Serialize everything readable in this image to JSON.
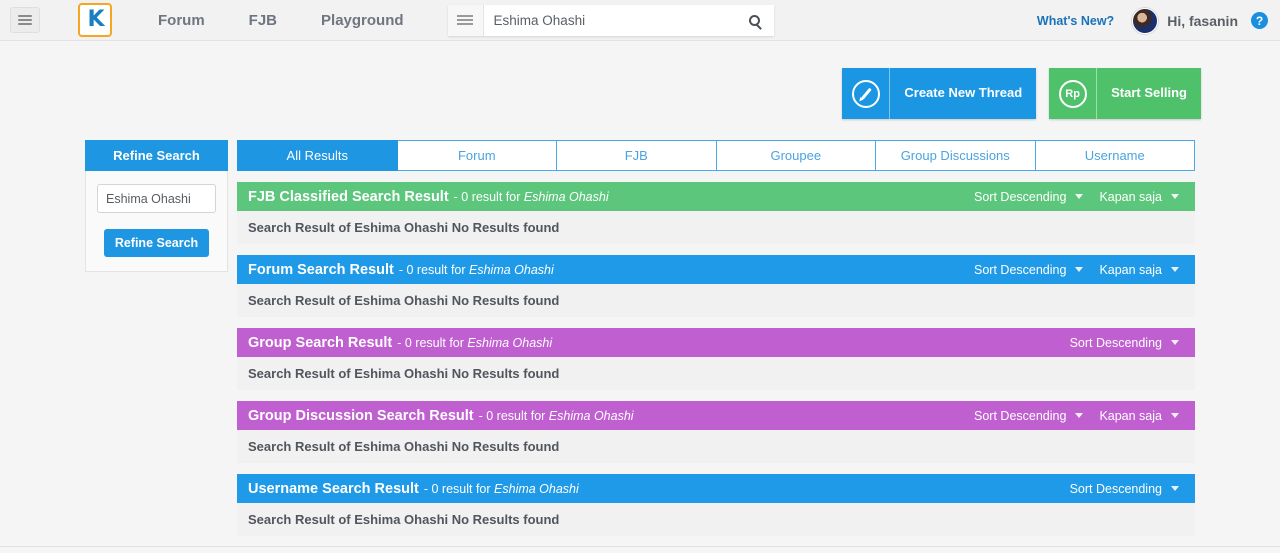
{
  "topnav": {
    "menu_icon": "hamburger-icon",
    "logo_text": "K",
    "links": [
      {
        "label": "Forum"
      },
      {
        "label": "FJB"
      },
      {
        "label": "Playground"
      }
    ],
    "search": {
      "category_icon": "hamburger-icon",
      "value": "Eshima Ohashi",
      "placeholder": "Search...",
      "submit_icon": "search-icon"
    },
    "whats_new": "What's New?",
    "avatar_name": "avatar",
    "greeting": "Hi, fasanin",
    "help_label": "?"
  },
  "actions": {
    "create_thread": {
      "label": "Create New Thread",
      "icon": "pencil-circle-icon"
    },
    "start_selling": {
      "label": "Start Selling",
      "icon": "rupiah-circle-icon",
      "icon_text": "Rp"
    }
  },
  "sidebar": {
    "title": "Refine Search",
    "input_value": "Eshima Ohashi",
    "input_placeholder": "Search...",
    "button_label": "Refine Search"
  },
  "tabs": [
    {
      "label": "All Results",
      "active": true
    },
    {
      "label": "Forum",
      "active": false
    },
    {
      "label": "FJB",
      "active": false
    },
    {
      "label": "Groupee",
      "active": false
    },
    {
      "label": "Group Discussions",
      "active": false
    },
    {
      "label": "Username",
      "active": false
    }
  ],
  "results": [
    {
      "title": "FJB Classified Search Result",
      "meta_prefix": "- 0 result for",
      "query": "Eshima Ohashi",
      "sort_label": "Sort Descending",
      "time_label": "Kapan saja",
      "body": "Search Result of Eshima Ohashi No Results found",
      "color": "#5cc77c",
      "style": "hd-green"
    },
    {
      "title": "Forum Search Result",
      "meta_prefix": "- 0 result for",
      "query": "Eshima Ohashi",
      "sort_label": "Sort Descending",
      "time_label": "Kapan saja",
      "body": "Search Result of Eshima Ohashi No Results found",
      "color": "#1e9ae8",
      "style": "hd-blue"
    },
    {
      "title": "Group Search Result",
      "meta_prefix": "- 0 result for",
      "query": "Eshima Ohashi",
      "sort_label": "Sort Descending",
      "time_label": "",
      "body": "Search Result of Eshima Ohashi No Results found",
      "color": "#c05fd0",
      "style": "hd-purple"
    },
    {
      "title": "Group Discussion Search Result",
      "meta_prefix": "- 0 result for",
      "query": "Eshima Ohashi",
      "sort_label": "Sort Descending",
      "time_label": "Kapan saja",
      "body": "Search Result of Eshima Ohashi No Results found",
      "color": "#c05fd0",
      "style": "hd-purple"
    },
    {
      "title": "Username Search Result",
      "meta_prefix": "- 0 result for",
      "query": "Eshima Ohashi",
      "sort_label": "Sort Descending",
      "time_label": "",
      "body": "Search Result of Eshima Ohashi No Results found",
      "color": "#1e9ae8",
      "style": "hd-blue"
    }
  ],
  "colors": {
    "accent_blue": "#1e96e2",
    "accent_green": "#4fc16b",
    "accent_purple": "#c05fd0",
    "logo_orange": "#f5a623"
  }
}
